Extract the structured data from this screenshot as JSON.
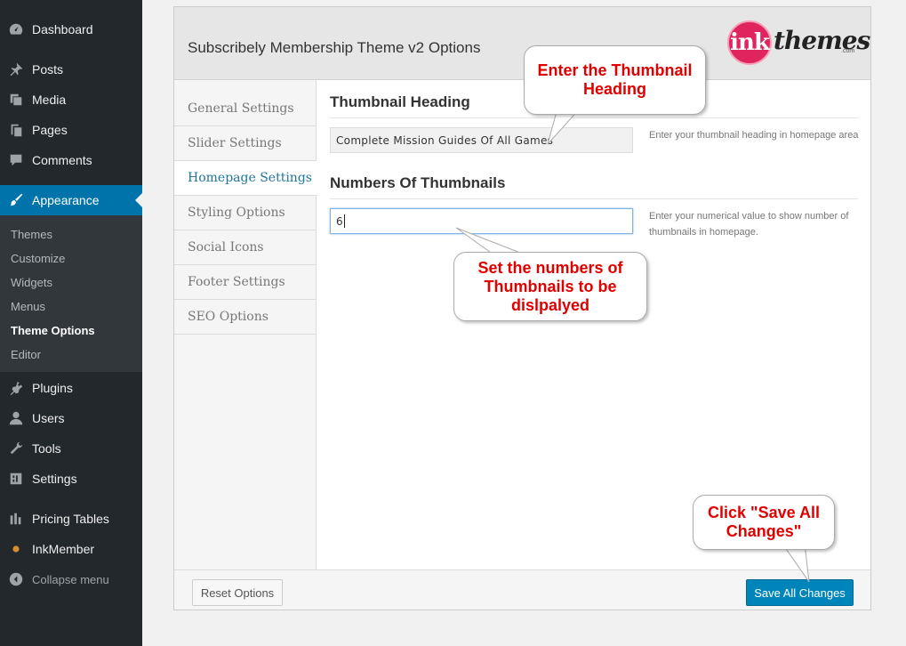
{
  "sidebar": {
    "items": [
      {
        "label": "Dashboard",
        "icon": "dashboard-icon"
      },
      {
        "label": "Posts",
        "icon": "pin-icon"
      },
      {
        "label": "Media",
        "icon": "media-icon"
      },
      {
        "label": "Pages",
        "icon": "pages-icon"
      },
      {
        "label": "Comments",
        "icon": "comment-icon"
      },
      {
        "label": "Appearance",
        "icon": "brush-icon"
      },
      {
        "label": "Plugins",
        "icon": "plug-icon"
      },
      {
        "label": "Users",
        "icon": "user-icon"
      },
      {
        "label": "Tools",
        "icon": "wrench-icon"
      },
      {
        "label": "Settings",
        "icon": "settings-icon"
      },
      {
        "label": "Pricing Tables",
        "icon": "bars-icon"
      },
      {
        "label": "InkMember",
        "icon": "inkmember-icon"
      }
    ],
    "submenu": [
      "Themes",
      "Customize",
      "Widgets",
      "Menus",
      "Theme Options",
      "Editor"
    ],
    "collapse_label": "Collapse menu"
  },
  "panel": {
    "title": "Subscribely Membership Theme v2 Options",
    "logo": {
      "mark": "ink",
      "word": "themes",
      "suffix": ".com"
    },
    "tabs": [
      "General Settings",
      "Slider Settings",
      "Homepage Settings",
      "Styling Options",
      "Social Icons",
      "Footer Settings",
      "SEO Options"
    ],
    "active_tab": "Homepage Settings"
  },
  "fields": {
    "thumbnail_heading": {
      "title": "Thumbnail Heading",
      "value": "Complete Mission Guides Of All Games",
      "help": "Enter your thumbnail heading in homepage area"
    },
    "thumbnail_count": {
      "title": "Numbers Of Thumbnails",
      "value": "6",
      "help": "Enter your numerical value to show number of thumbnails in homepage."
    }
  },
  "footer": {
    "reset_label": "Reset Options",
    "save_label": "Save All Changes"
  },
  "callouts": {
    "heading": "Enter the Thumbnail Heading",
    "numbers": "Set the numbers of Thumbnails to be dislpalyed",
    "save": "Click \"Save All Changes\""
  },
  "colors": {
    "sidebar_bg": "#23282d",
    "accent": "#0073aa",
    "callout_text": "#e00000",
    "save_button": "#0085ba"
  }
}
